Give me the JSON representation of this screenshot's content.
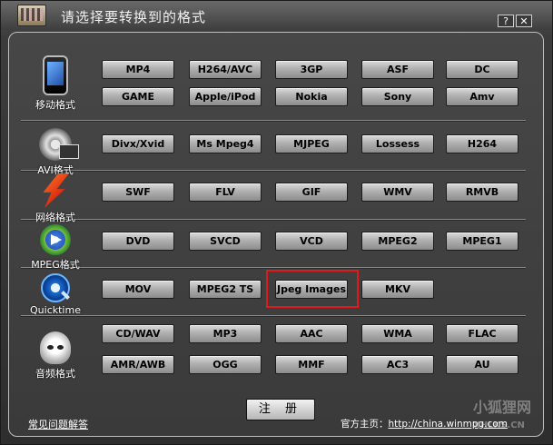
{
  "window": {
    "title": "请选择要转换到的格式",
    "help_label": "?",
    "close_label": "✕"
  },
  "categories": [
    {
      "label": "移动格式",
      "icon": "mobile-phone-icon"
    },
    {
      "label": "AVI格式",
      "icon": "avi-film-icon"
    },
    {
      "label": "网络格式",
      "icon": "flash-icon"
    },
    {
      "label": "MPEG格式",
      "icon": "mpeg-play-icon"
    },
    {
      "label": "Quicktime",
      "icon": "quicktime-icon"
    },
    {
      "label": "音频格式",
      "icon": "audio-icon"
    }
  ],
  "formats": {
    "mobile_row1": [
      "MP4",
      "H264/AVC",
      "3GP",
      "ASF",
      "DC"
    ],
    "mobile_row2": [
      "GAME",
      "Apple/iPod",
      "Nokia",
      "Sony",
      "Amv"
    ],
    "avi": [
      "Divx/Xvid",
      "Ms Mpeg4",
      "MJPEG",
      "Lossess",
      "H264"
    ],
    "web": [
      "SWF",
      "FLV",
      "GIF",
      "WMV",
      "RMVB"
    ],
    "mpeg": [
      "DVD",
      "SVCD",
      "VCD",
      "MPEG2",
      "MPEG1"
    ],
    "quicktime": [
      "MOV",
      "MPEG2 TS",
      "Jpeg Images",
      "MKV"
    ],
    "audio_row1": [
      "CD/WAV",
      "MP3",
      "AAC",
      "WMA",
      "FLAC"
    ],
    "audio_row2": [
      "AMR/AWB",
      "OGG",
      "MMF",
      "AC3",
      "AU"
    ]
  },
  "highlighted_format": "Jpeg Images",
  "footer": {
    "register_label": "注 册",
    "faq_label": "常见问题解答",
    "homepage_prefix": "官方主页：",
    "homepage_url": "http://china.winmpg.com"
  },
  "watermark": {
    "text": "小狐狸网",
    "sub": "XHLKS.CN"
  },
  "colors": {
    "window_bg": "#3a3a3a",
    "button_face": "#b0b0b0",
    "highlight_box": "#e0191b",
    "text_light": "#ffffff"
  }
}
